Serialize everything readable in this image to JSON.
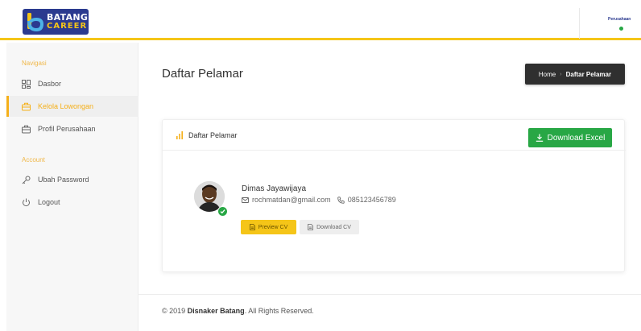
{
  "header": {
    "logo_line1": "BATANG",
    "logo_line2": "CAREER",
    "user_name": "Perusahaan"
  },
  "sidebar": {
    "section_navigasi": "Navigasi",
    "section_account": "Account",
    "items": [
      {
        "label": "Dasbor",
        "icon": "dashboard-icon"
      },
      {
        "label": "Kelola Lowongan",
        "icon": "briefcase-icon",
        "active": true
      },
      {
        "label": "Profil Perusahaan",
        "icon": "building-icon"
      },
      {
        "label": "Ubah Password",
        "icon": "key-icon"
      },
      {
        "label": "Logout",
        "icon": "power-icon"
      }
    ]
  },
  "main": {
    "page_title": "Daftar Pelamar",
    "breadcrumb": {
      "home": "Home",
      "current": "Daftar Pelamar"
    },
    "card": {
      "title": "Daftar Pelamar",
      "download_excel": "Download Excel",
      "applicant": {
        "name": "Dimas Jayawijaya",
        "email": "rochmatdan@gmail.com",
        "phone": "085123456789",
        "preview_cv": "Preview CV",
        "download_cv": "Download CV"
      }
    }
  },
  "footer": {
    "prefix": "© 2019",
    "org": "Disnaker Batang",
    "suffix": ". All Rights Reserved."
  },
  "colors": {
    "accent": "#f5b01a",
    "brand": "#2b3a8f",
    "success": "#28a745"
  }
}
